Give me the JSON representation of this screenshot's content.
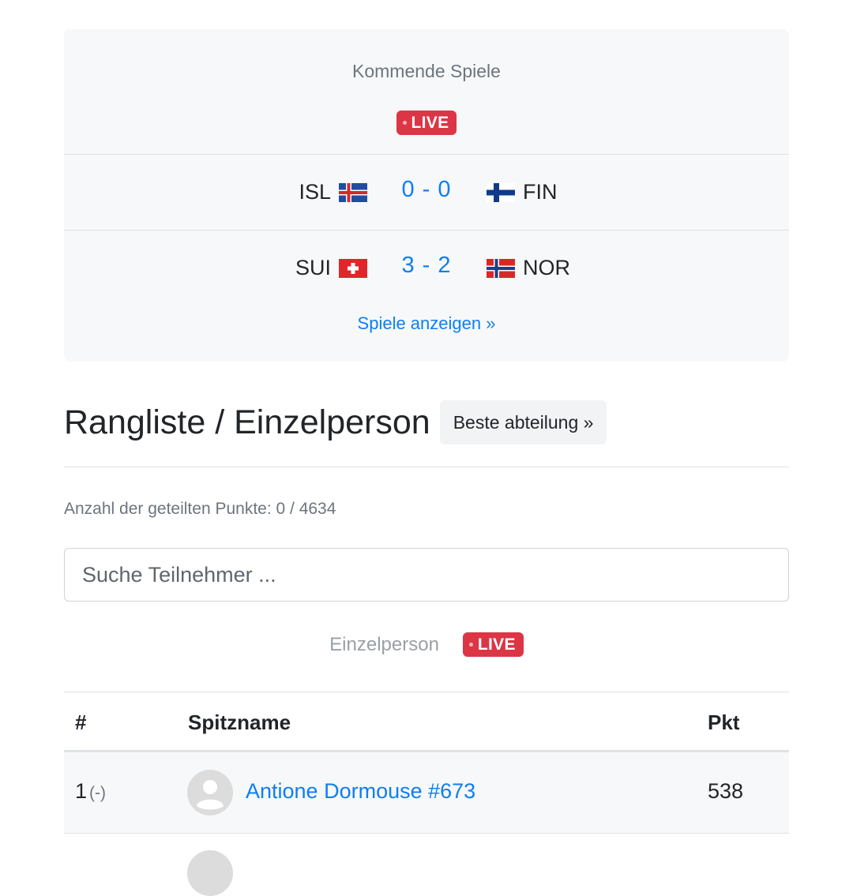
{
  "games": {
    "title": "Kommende Spiele",
    "live_label": "LIVE",
    "matches": [
      {
        "home": "ISL",
        "away": "FIN",
        "score": "0 - 0",
        "home_flag": "iceland-flag-icon",
        "away_flag": "finland-flag-icon"
      },
      {
        "home": "SUI",
        "away": "NOR",
        "score": "3 - 2",
        "home_flag": "switzerland-flag-icon",
        "away_flag": "norway-flag-icon"
      }
    ],
    "show_games_link": "Spiele anzeigen »"
  },
  "ranking": {
    "title": "Rangliste / Einzelperson",
    "best_department_button": "Beste abteilung »",
    "shared_points": "Anzahl der geteilten Punkte: 0 / 4634",
    "search_placeholder": "Suche Teilnehmer ...",
    "tab_label": "Einzelperson",
    "live_label": "LIVE"
  },
  "table": {
    "headers": {
      "rank": "#",
      "name": "Spitzname",
      "points": "Pkt"
    },
    "rows": [
      {
        "rank": "1",
        "delta": "(-)",
        "name": "Antione Dormouse #673",
        "points": "538"
      }
    ]
  },
  "colors": {
    "accent": "#0d7ef5",
    "live": "#dc3545",
    "card_bg": "#f7f8f9"
  }
}
